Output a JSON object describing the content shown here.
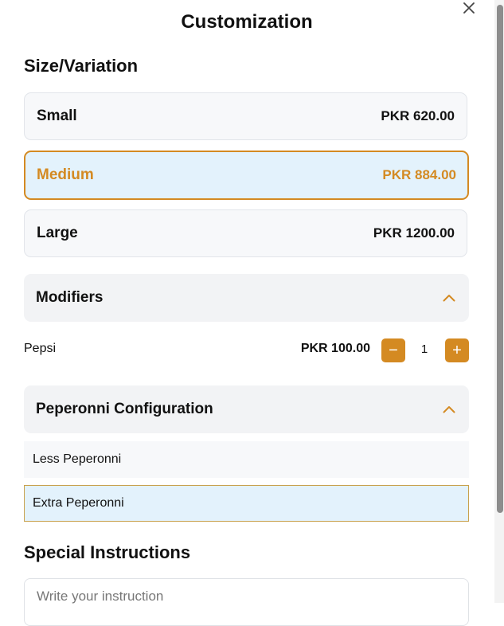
{
  "modal": {
    "title": "Customization"
  },
  "size_section": {
    "heading": "Size/Variation",
    "options": [
      {
        "name": "Small",
        "price": "PKR 620.00",
        "selected": false
      },
      {
        "name": "Medium",
        "price": "PKR 884.00",
        "selected": true
      },
      {
        "name": "Large",
        "price": "PKR 1200.00",
        "selected": false
      }
    ]
  },
  "modifiers": {
    "label": "Modifiers",
    "expanded": true,
    "items": [
      {
        "name": "Pepsi",
        "price": "PKR 100.00",
        "quantity": "1",
        "minus": "−",
        "plus": "+"
      }
    ]
  },
  "peperonni_config": {
    "label": "Peperonni Configuration",
    "expanded": true,
    "options": [
      {
        "label": "Less Peperonni",
        "selected": false
      },
      {
        "label": "Extra Peperonni",
        "selected": true
      }
    ]
  },
  "special_instructions": {
    "heading": "Special Instructions",
    "placeholder": "Write your instruction"
  },
  "colors": {
    "accent": "#d48a22",
    "selected_bg": "#e3f2fc",
    "card_bg": "#f7f8fa"
  },
  "icons": {
    "close": "close-icon",
    "collapse": "chevron-up-icon"
  }
}
